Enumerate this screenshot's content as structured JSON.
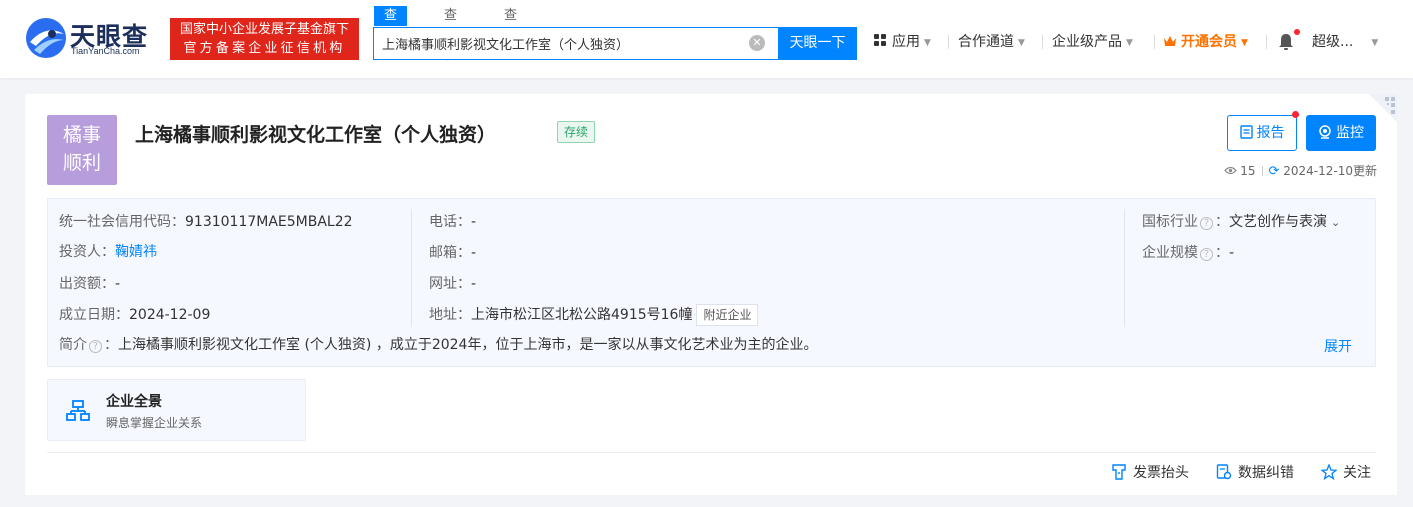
{
  "header": {
    "logo_text": "天眼查",
    "logo_sub": "TianYanCha.com",
    "banner_line1": "国家中小企业发展子基金旗下",
    "banner_line2": "官方备案企业征信机构",
    "search_tabs": [
      "查公司",
      "查老板",
      "查关系"
    ],
    "search_value": "上海橘事顺利影视文化工作室（个人独资）",
    "search_button": "天眼一下",
    "nav_items": [
      "应用",
      "合作通道",
      "企业级产品",
      "开通会员",
      "超级..."
    ],
    "colors": {
      "brand_blue": "#0084ff",
      "banner_red": "#e0251b",
      "vip_orange": "#ff7200"
    }
  },
  "company": {
    "avatar_line1": "橘事",
    "avatar_line2": "顺利",
    "name": "上海橘事顺利影视文化工作室（个人独资）",
    "status": "存续",
    "report_button": "报告",
    "monitor_button": "监控",
    "views": "15",
    "updated": "2024-12-10更新"
  },
  "info": {
    "credit_code_label": "统一社会信用代码：",
    "credit_code": "91310117MAE5MBAL22",
    "investor_label": "投资人：",
    "investor": "鞠婧祎",
    "capital_label": "出资额：",
    "capital": "-",
    "founded_label": "成立日期：",
    "founded": "2024-12-09",
    "phone_label": "电话：",
    "phone": "-",
    "email_label": "邮箱：",
    "email": "-",
    "website_label": "网址：",
    "website": "-",
    "address_label": "地址：",
    "address": "上海市松江区北松公路4915号16幢",
    "nearby_button": "附近企业",
    "industry_label": "国标行业",
    "industry": "文艺创作与表演",
    "scale_label": "企业规模",
    "scale": "-",
    "intro_label": "简介",
    "intro": "上海橘事顺利影视文化工作室 (个人独资) ，成立于2024年，位于上海市，是一家以从事文化艺术业为主的企业。",
    "expand": "展开"
  },
  "overview": {
    "title": "企业全景",
    "subtitle": "瞬息掌握企业关系"
  },
  "footer_actions": [
    "发票抬头",
    "数据纠错",
    "关注"
  ]
}
